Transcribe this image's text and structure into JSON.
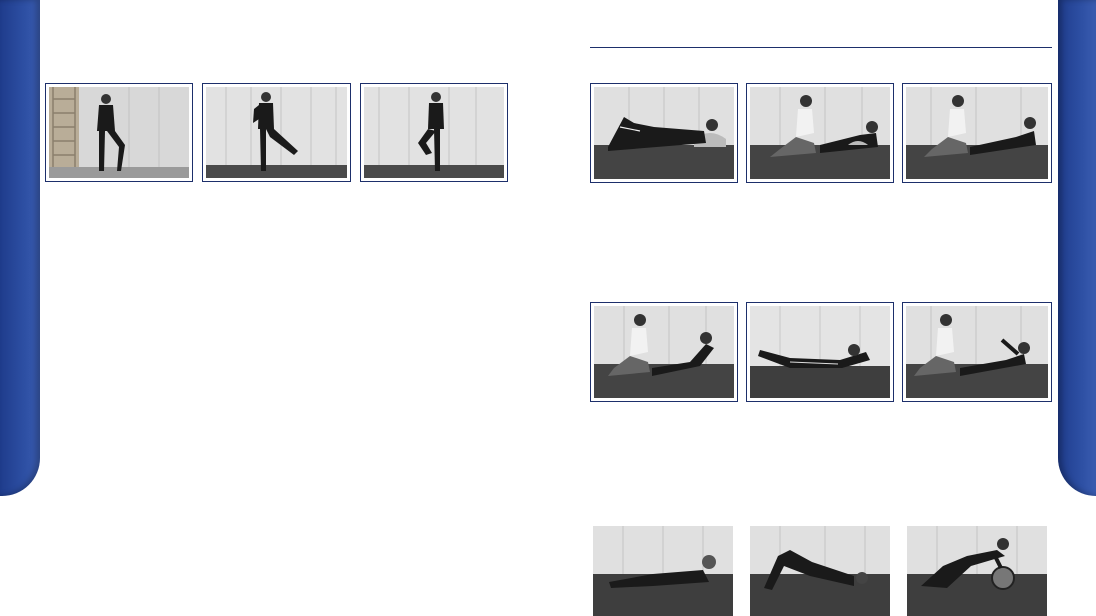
{
  "page": {
    "accent_color": "#1f3c8c",
    "frame_color": "#1d2f6b"
  },
  "left_page": {
    "photos": [
      {
        "id": "left-photo-1",
        "scene": "standing-wall-bars"
      },
      {
        "id": "left-photo-2",
        "scene": "standing-leg-raise"
      },
      {
        "id": "left-photo-3",
        "scene": "standing-knee-raise"
      }
    ]
  },
  "right_page": {
    "rows": [
      {
        "photos": [
          {
            "id": "photo-row1-1",
            "scene": "lying-back-bolster"
          },
          {
            "id": "photo-row1-2",
            "scene": "assisted-prone-bolster"
          },
          {
            "id": "photo-row1-3",
            "scene": "assisted-prone-stretch"
          }
        ]
      },
      {
        "photos": [
          {
            "id": "photo-row2-1",
            "scene": "assisted-prone-extension"
          },
          {
            "id": "photo-row2-2",
            "scene": "prone-superman"
          },
          {
            "id": "photo-row2-3",
            "scene": "assisted-prone-arm-raise"
          }
        ]
      },
      {
        "photos": [
          {
            "id": "photo-row3-1",
            "scene": "side-lying"
          },
          {
            "id": "photo-row3-2",
            "scene": "glute-bridge"
          },
          {
            "id": "photo-row3-3",
            "scene": "kneeling-ball-roll"
          }
        ]
      }
    ]
  }
}
